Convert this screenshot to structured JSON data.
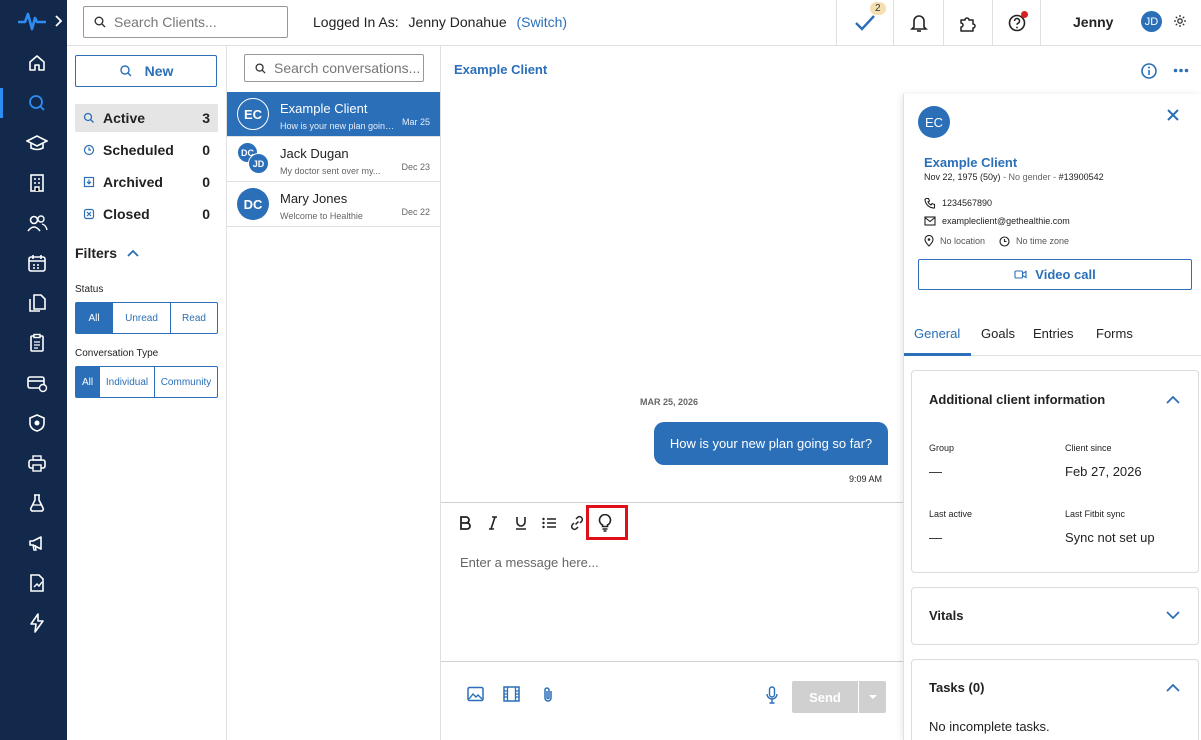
{
  "topbar": {
    "search_placeholder": "Search Clients...",
    "logged_in_label": "Logged In As:",
    "logged_in_user": "Jenny Donahue",
    "switch_label": "(Switch)",
    "tasks_badge": "2",
    "user_name": "Jenny",
    "user_initials": "JD"
  },
  "nav": {
    "new_label": "New",
    "folders": [
      {
        "label": "Active",
        "count": "3"
      },
      {
        "label": "Scheduled",
        "count": "0"
      },
      {
        "label": "Archived",
        "count": "0"
      },
      {
        "label": "Closed",
        "count": "0"
      }
    ],
    "filters_label": "Filters",
    "status_label": "Status",
    "status_options": [
      "All",
      "Unread",
      "Read"
    ],
    "type_label": "Conversation Type",
    "type_options": [
      "All",
      "Individual",
      "Community"
    ]
  },
  "conversations": {
    "search_placeholder": "Search conversations...",
    "items": [
      {
        "initials": "EC",
        "name": "Example Client",
        "preview": "How is your new plan going so far?",
        "date": "Mar 25"
      },
      {
        "initials": "DC",
        "initials2": "JD",
        "name": "Jack Dugan",
        "preview": "My doctor sent over my...",
        "date": "Dec 23"
      },
      {
        "initials": "DC",
        "name": "Mary Jones",
        "preview": "Welcome to Healthie",
        "date": "Dec 22"
      }
    ]
  },
  "chat": {
    "title": "Example Client",
    "date_separator": "MAR 25, 2026",
    "message": "How is your new plan going so far?",
    "message_time": "9:09 AM",
    "composer_placeholder": "Enter a message here...",
    "send_label": "Send"
  },
  "client": {
    "initials": "EC",
    "name": "Example Client",
    "dob": "Nov 22, 1975 (50y)",
    "gender": "- No gender -",
    "id": "#13900542",
    "phone": "1234567890",
    "email": "exampleclient@gethealthie.com",
    "location": "No location",
    "timezone": "No time zone",
    "video_call_label": "Video call",
    "tabs": [
      "General",
      "Goals",
      "Entries",
      "Forms"
    ],
    "additional_title": "Additional client information",
    "group_label": "Group",
    "group_value": "—",
    "client_since_label": "Client since",
    "client_since_value": "Feb 27, 2026",
    "last_active_label": "Last active",
    "last_active_value": "—",
    "fitbit_label": "Last Fitbit sync",
    "fitbit_value": "Sync not set up",
    "vitals_title": "Vitals",
    "tasks_title": "Tasks (0)",
    "tasks_empty": "No incomplete tasks."
  },
  "colors": {
    "rail": "#13294b",
    "accent": "#2a6fb8",
    "highlight": "#e0101a"
  }
}
